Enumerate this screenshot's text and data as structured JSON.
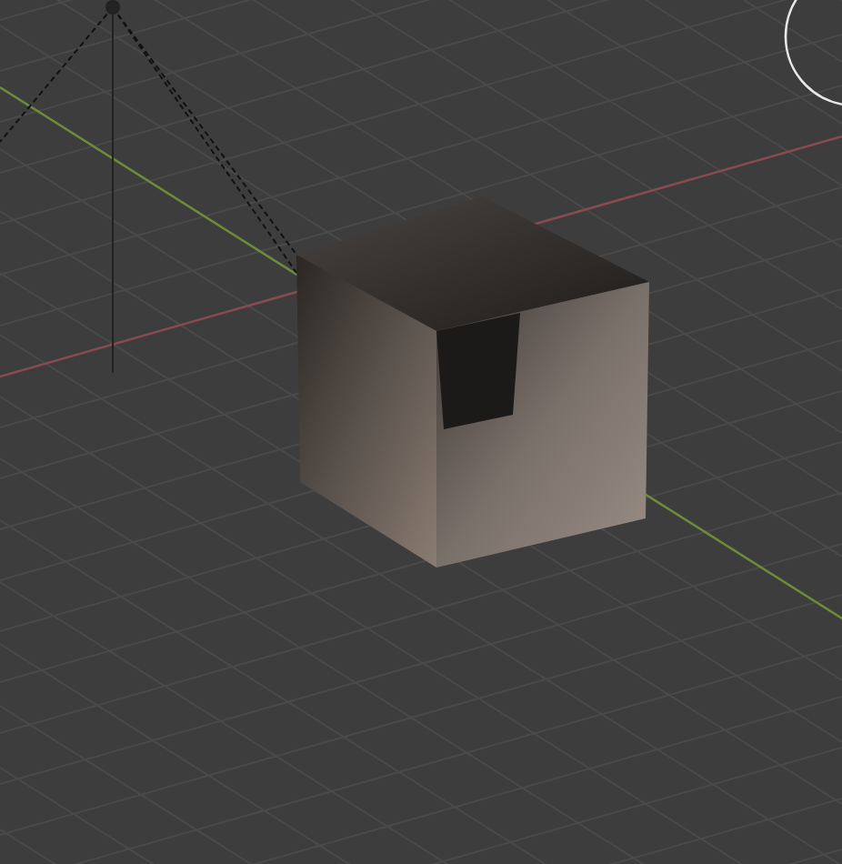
{
  "viewport": {
    "grid": true,
    "objects": [
      {
        "kind": "camera"
      },
      {
        "kind": "cube"
      },
      {
        "kind": "lamp"
      }
    ]
  }
}
